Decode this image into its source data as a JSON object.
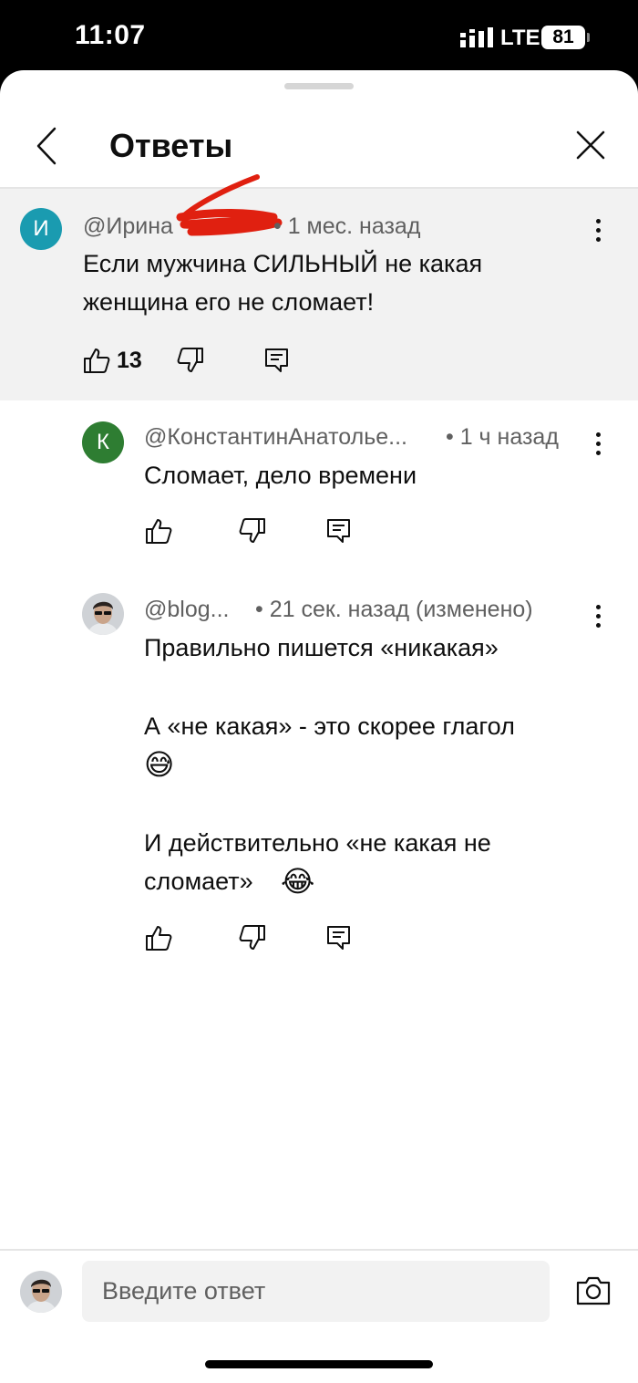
{
  "status_bar": {
    "time": "11:07",
    "network": "LTE",
    "battery": "81"
  },
  "header": {
    "title": "Ответы"
  },
  "parent_comment": {
    "avatar_letter": "И",
    "author": "@Ирина",
    "time": "• 1 мес. назад",
    "text": "Если мужчина СИЛЬНЫЙ не какая женщина его не сломает!",
    "likes": "13",
    "avatar_color": "#1a9bb0"
  },
  "replies": [
    {
      "avatar_letter": "К",
      "author": "@КонстантинАнатолье...",
      "time": "• 1 ч назад",
      "text": "Сломает, дело времени",
      "avatar_color": "#2e7d32"
    },
    {
      "author": "@blog...",
      "time": "• 21 сек. назад (изменено)",
      "text_line1": "Правильно пишется «никакая»",
      "text_line2": "А «не какая» - это скорее глагол",
      "text_line2_emoji": "😅",
      "text_line3a": "И действительно «не какая не",
      "text_line3b": "сломает»",
      "text_line3_emoji": "😂"
    }
  ],
  "reply_box": {
    "placeholder": "Введите ответ"
  },
  "colors": {
    "redaction": "#e02010",
    "sheet_gray": "#f2f2f2"
  }
}
